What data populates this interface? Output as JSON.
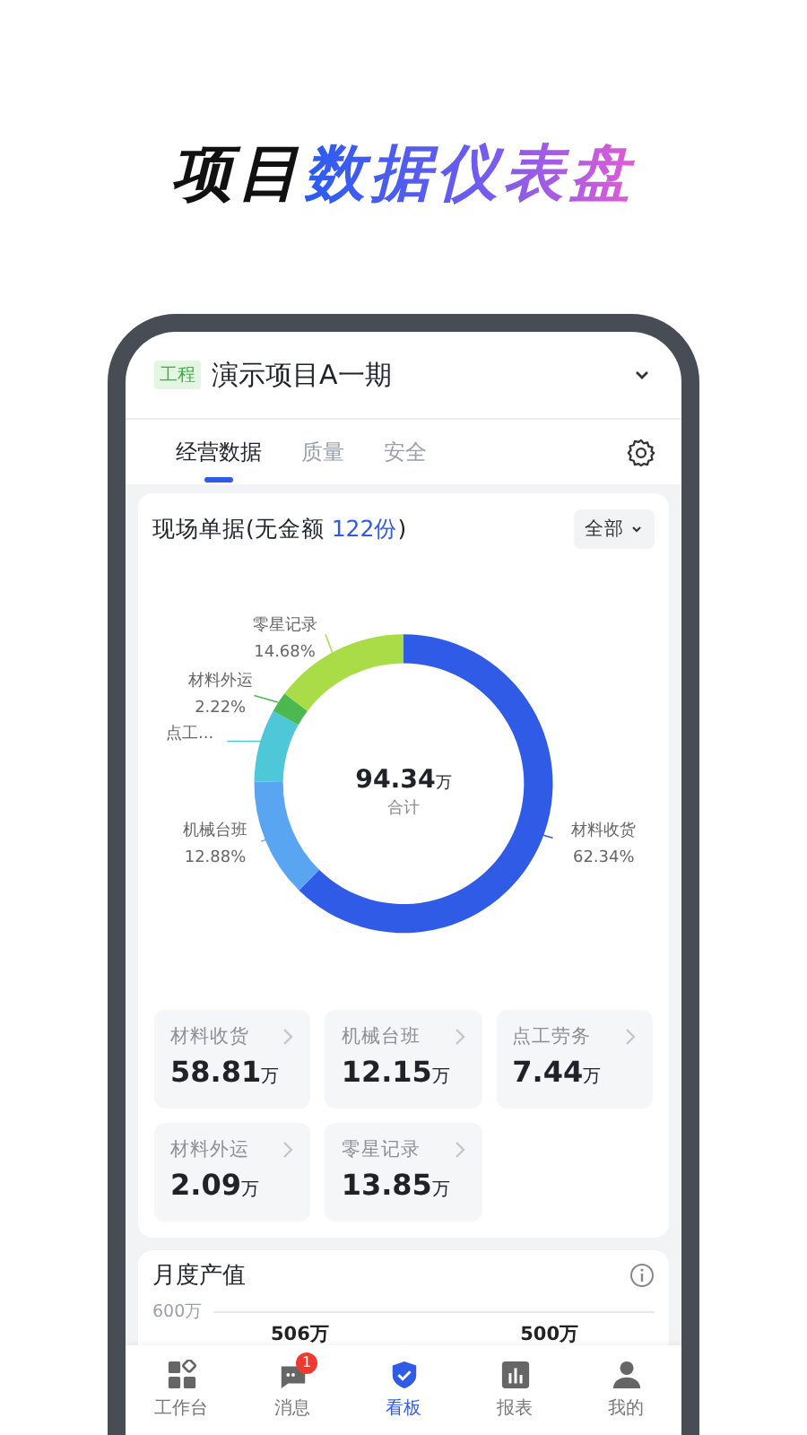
{
  "headline": {
    "plain": "项目",
    "highlight": "数据仪表盘"
  },
  "header": {
    "tag": "工程",
    "title": "演示项目A一期"
  },
  "tabs": [
    {
      "label": "经营数据",
      "selected": true
    },
    {
      "label": "质量",
      "selected": false
    },
    {
      "label": "安全",
      "selected": false
    }
  ],
  "documents_card": {
    "title": "现场单据(无金额 ",
    "count": "122份",
    "title_end": ")",
    "filter": "全部",
    "chart_data": {
      "type": "donut",
      "categories": [
        "材料收货",
        "机械台班",
        "点工...",
        "材料外运",
        "零星记录"
      ],
      "values": [
        62.34,
        12.88,
        7.88,
        2.22,
        14.68
      ],
      "colors": [
        "#2f5be7",
        "#5aa5f2",
        "#4ec8d8",
        "#4cb850",
        "#a9dc46"
      ],
      "value_labels": [
        "62.34%",
        "12.88%",
        null,
        "2.22%",
        "14.68%"
      ]
    },
    "total": {
      "value": "94.34",
      "unit": "万",
      "label": "合计"
    },
    "tiles": [
      {
        "label": "材料收货",
        "value": "58.81",
        "unit": "万"
      },
      {
        "label": "机械台班",
        "value": "12.15",
        "unit": "万"
      },
      {
        "label": "点工劳务",
        "value": "7.44",
        "unit": "万"
      },
      {
        "label": "材料外运",
        "value": "2.09",
        "unit": "万"
      },
      {
        "label": "零星记录",
        "value": "13.85",
        "unit": "万"
      }
    ]
  },
  "monthly_card": {
    "title": "月度产值",
    "y_tick": "600万",
    "value_labels": [
      "506万",
      "500万"
    ]
  },
  "bottom_nav": [
    {
      "label": "工作台",
      "kind": "workbench",
      "selected": false
    },
    {
      "label": "消息",
      "kind": "messages",
      "selected": false,
      "badge": "1"
    },
    {
      "label": "看板",
      "kind": "dashboard",
      "selected": true
    },
    {
      "label": "报表",
      "kind": "reports",
      "selected": false
    },
    {
      "label": "我的",
      "kind": "profile",
      "selected": false
    }
  ]
}
